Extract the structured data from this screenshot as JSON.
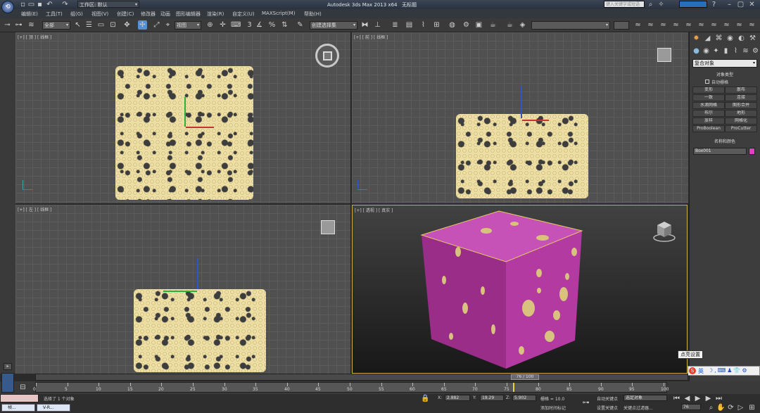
{
  "app": {
    "title": "Autodesk 3ds Max  2013 x64",
    "file_name": "无标题",
    "workspace": "工作区: 默认",
    "search_placeholder": "键入关键字或短语"
  },
  "menu": [
    "编辑(E)",
    "工具(T)",
    "组(G)",
    "视图(V)",
    "创建(C)",
    "修改器",
    "动画",
    "图形编辑器",
    "渲染(R)",
    "自定义(U)",
    "MAXScript(M)",
    "帮助(H)"
  ],
  "toolbar": {
    "filter_value": "全部",
    "coord_system": "视图",
    "named_selection": "创建选择集",
    "number_3": "3"
  },
  "viewports": {
    "top_label": "[+] [ 顶 ] [ 线框 ]",
    "front_label": "[+] [ 前 ] [ 线框 ]",
    "left_label": "[+] [ 左 ] [ 线框 ]",
    "persp_label": "[+] [ 透视 ] [ 真实 ]"
  },
  "command_panel": {
    "category_value": "复合对象",
    "object_type_header": "对象类型",
    "autogrid_label": "自动栅格",
    "buttons": [
      "变形",
      "散布",
      "一致",
      "连接",
      "水滴网格",
      "图形合并",
      "布尔",
      "地形",
      "放样",
      "网格化",
      "ProBoolean",
      "ProCutter"
    ],
    "name_color_header": "名称和颜色",
    "object_name": "Box001",
    "object_color": "#e040c8"
  },
  "tooltip": "点亮设置",
  "timeline": {
    "frame_display": "76 / 100",
    "current_frame": 76,
    "total_frames": 100,
    "ticks": [
      "0",
      "5",
      "10",
      "15",
      "20",
      "25",
      "30",
      "35",
      "40",
      "45",
      "50",
      "55",
      "60",
      "65",
      "70",
      "75",
      "80",
      "85",
      "90",
      "95",
      "100"
    ]
  },
  "status": {
    "selection_text": "选择了 1 个对象",
    "x_label": "X:",
    "x_value": "2.882",
    "y_label": "Y:",
    "y_value": "18.29",
    "z_label": "Z:",
    "z_value": "5.902",
    "grid_text": "栅格 = 10.0",
    "auto_key": "自动关键点",
    "set_key": "设置关键点",
    "selected_object": "选定对象",
    "key_filter": "关键点过滤器...",
    "add_time_tag": "添加时间标记",
    "frame_field": "76",
    "taskbar_1": "帧...",
    "taskbar_2": "V-R...",
    "ime_label": "英"
  },
  "colors": {
    "foam": "#e7d59a",
    "cube": "#9a2d88",
    "viewport_active_border": "#cdb04a"
  }
}
